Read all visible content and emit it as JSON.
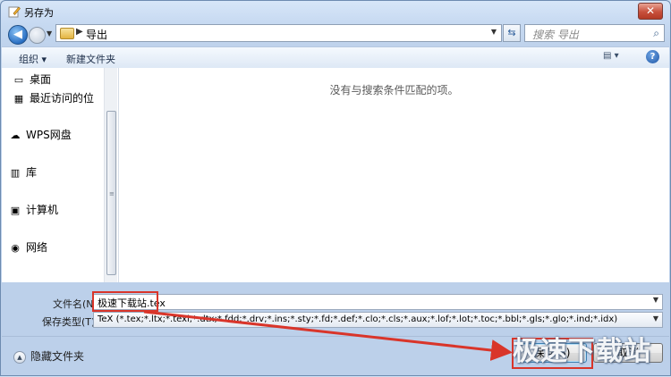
{
  "window": {
    "title": "另存为",
    "close_glyph": "✕"
  },
  "nav": {
    "breadcrumb": [
      "导出"
    ],
    "search_placeholder": "搜索 导出"
  },
  "toolbar": {
    "organize_label": "组织 ▾",
    "new_folder_label": "新建文件夹"
  },
  "sidebar": {
    "items": [
      {
        "label": "桌面",
        "icon": "desktop-icon"
      },
      {
        "label": "最近访问的位",
        "icon": "recent-places-icon"
      },
      {
        "label": "WPS网盘",
        "icon": "cloud-icon"
      },
      {
        "label": "库",
        "icon": "library-icon"
      },
      {
        "label": "计算机",
        "icon": "computer-icon"
      },
      {
        "label": "网络",
        "icon": "network-icon"
      }
    ]
  },
  "content": {
    "empty_message": "没有与搜索条件匹配的项。"
  },
  "fields": {
    "filename_label": "文件名(N):",
    "filename_value": "极速下载站.tex",
    "savetype_label": "保存类型(T):",
    "savetype_value": "TeX (*.tex;*.ltx;*.texi;*.dtx;*.fdd;*.drv;*.ins;*.sty;*.fd;*.def;*.clo;*.cls;*.aux;*.lof;*.lot;*.toc;*.bbl;*.gls;*.glo;*.ind;*.idx)"
  },
  "footer": {
    "hide_folders_label": "隐藏文件夹",
    "save_label": "保存(S)",
    "cancel_label": "取消"
  },
  "watermark": {
    "text": "极速下载站"
  },
  "colors": {
    "highlight": "#d9352a"
  }
}
